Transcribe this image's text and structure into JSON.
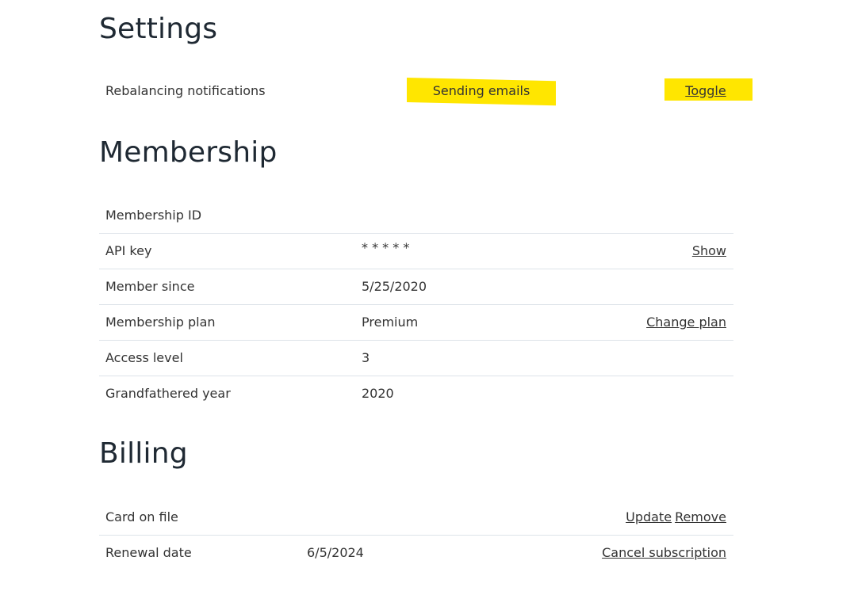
{
  "settings": {
    "heading": "Settings",
    "rows": [
      {
        "label": "Rebalancing notifications",
        "status": "Sending emails",
        "action": "Toggle"
      }
    ]
  },
  "membership": {
    "heading": "Membership",
    "rows": [
      {
        "label": "Membership ID",
        "value": "",
        "action": ""
      },
      {
        "label": "API key",
        "value": "* * * * *",
        "action": "Show"
      },
      {
        "label": "Member since",
        "value": "5/25/2020",
        "action": ""
      },
      {
        "label": "Membership plan",
        "value": "Premium",
        "action": "Change plan"
      },
      {
        "label": "Access level",
        "value": "3",
        "action": ""
      },
      {
        "label": "Grandfathered year",
        "value": "2020",
        "action": ""
      }
    ]
  },
  "billing": {
    "heading": "Billing",
    "rows": [
      {
        "label": "Card on file",
        "value": "",
        "actions": [
          "Update",
          "Remove"
        ]
      },
      {
        "label": "Renewal date",
        "value": "6/5/2024",
        "actions": [
          "Cancel subscription"
        ]
      }
    ]
  },
  "colors": {
    "highlight": "#ffe600",
    "divider": "#dde3e9",
    "heading_text": "#1f2933",
    "body_text": "#333333"
  }
}
